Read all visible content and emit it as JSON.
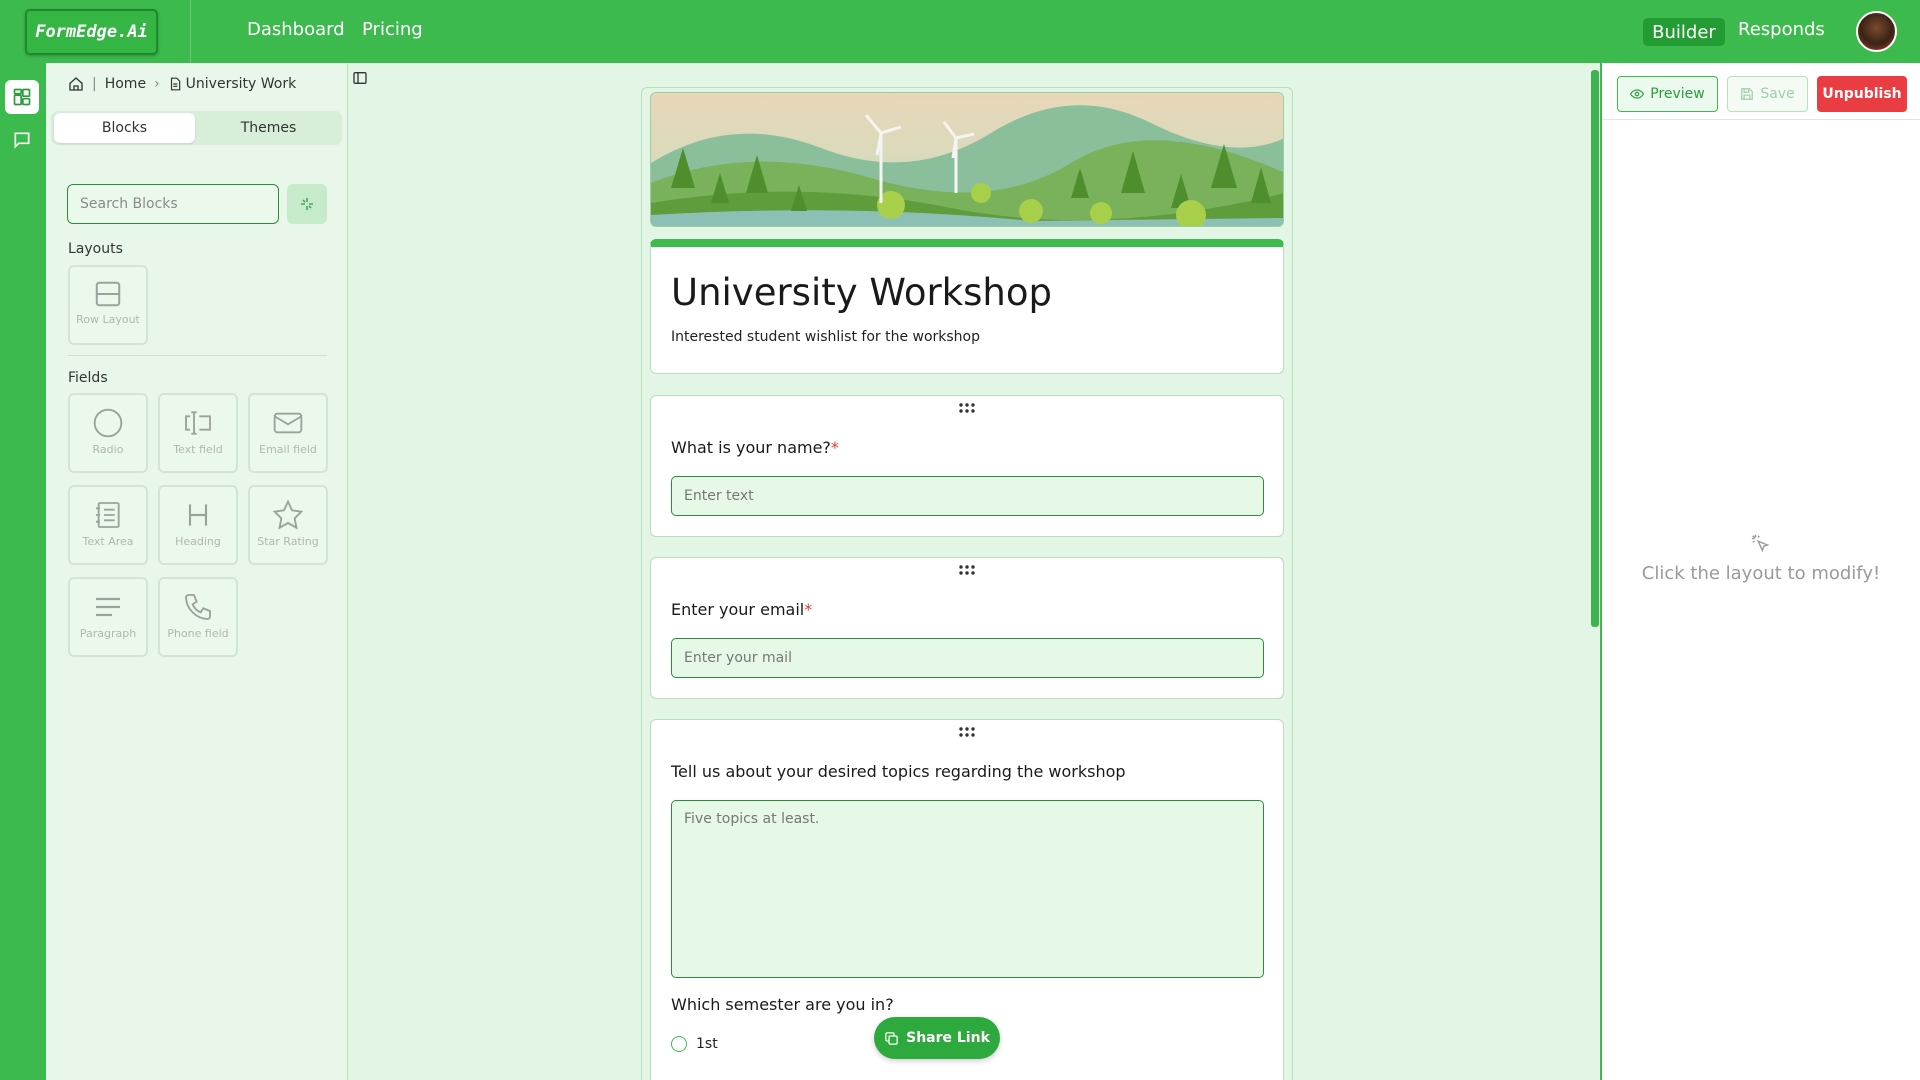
{
  "app": {
    "logo": "FormEdge.Ai"
  },
  "nav": {
    "dashboard": "Dashboard",
    "pricing": "Pricing",
    "builder": "Builder",
    "responds": "Responds"
  },
  "breadcrumb": {
    "home": "Home",
    "current": "University Work"
  },
  "sidebar": {
    "tabs": [
      "Blocks",
      "Themes"
    ],
    "search_placeholder": "Search Blocks",
    "layouts_label": "Layouts",
    "layouts": [
      {
        "label": "Row Layout",
        "icon": "row-layout-icon"
      }
    ],
    "fields_label": "Fields",
    "fields": [
      {
        "label": "Radio",
        "icon": "radio-icon"
      },
      {
        "label": "Text field",
        "icon": "text-field-icon"
      },
      {
        "label": "Email field",
        "icon": "email-icon"
      },
      {
        "label": "Text Area",
        "icon": "text-area-icon"
      },
      {
        "label": "Heading",
        "icon": "heading-icon"
      },
      {
        "label": "Star Rating",
        "icon": "star-icon"
      },
      {
        "label": "Paragraph",
        "icon": "paragraph-icon"
      },
      {
        "label": "Phone field",
        "icon": "phone-icon"
      }
    ]
  },
  "form": {
    "title": "University Workshop",
    "description": "Interested student wishlist for the workshop",
    "questions": [
      {
        "label": "What is your name?",
        "required": "*",
        "placeholder": "Enter text"
      },
      {
        "label": "Enter your email",
        "required": "*",
        "placeholder": "Enter your mail"
      },
      {
        "label": "Tell us about your desired topics regarding the workshop",
        "placeholder": "Five topics at least."
      },
      {
        "label": "Which semester are you in?",
        "options": [
          "1st"
        ]
      }
    ]
  },
  "share": {
    "label": "Share Link"
  },
  "panel": {
    "preview": "Preview",
    "save": "Save",
    "unpublish": "Unpublish",
    "empty_message": "Click the layout to modify!"
  },
  "colors": {
    "brand": "#3dba4e",
    "danger": "#ea3d43",
    "canvas": "#e3f5e5"
  }
}
